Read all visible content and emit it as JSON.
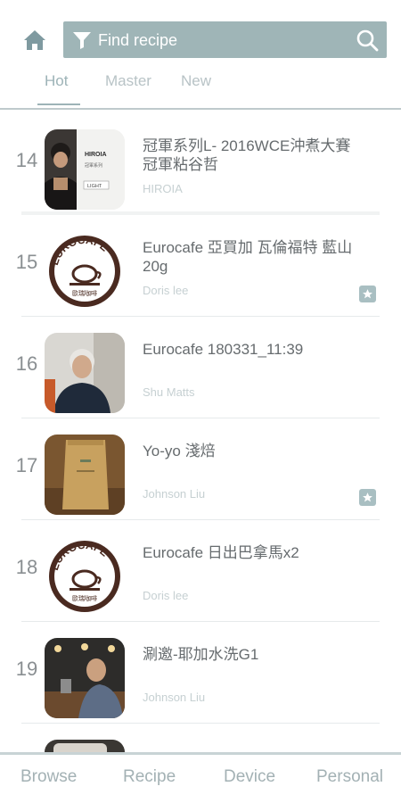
{
  "search": {
    "placeholder": "Find recipe"
  },
  "tabs": [
    {
      "label": "Hot",
      "active": true
    },
    {
      "label": "Master",
      "active": false
    },
    {
      "label": "New",
      "active": false
    }
  ],
  "recipes": [
    {
      "number": "14",
      "title": "冠軍系列L- 2016WCE沖煮大賽冠軍粘谷哲",
      "author": "HIROIA",
      "starred": false,
      "thumb": "hiroia-light-photo"
    },
    {
      "number": "15",
      "title": "Eurocafe 亞買加 瓦倫福特 藍山 20g",
      "author": "Doris lee",
      "starred": true,
      "thumb": "eurocafe-logo"
    },
    {
      "number": "16",
      "title": "Eurocafe 180331_11:39",
      "author": "Shu Matts",
      "starred": false,
      "thumb": "portrait-photo"
    },
    {
      "number": "17",
      "title": "Yo-yo 淺焙",
      "author": "Johnson Liu",
      "starred": true,
      "thumb": "coffee-bag-photo"
    },
    {
      "number": "18",
      "title": "Eurocafe 日出巴拿馬x2",
      "author": "Doris lee",
      "starred": false,
      "thumb": "eurocafe-logo"
    },
    {
      "number": "19",
      "title": "涮邀-耶加水洗G1",
      "author": "Johnson Liu",
      "starred": false,
      "thumb": "bar-photo"
    }
  ],
  "thumb_text": {
    "hiroia_brand": "HIROIA",
    "hiroia_sub": "冠軍系列",
    "hiroia_light": "LIGHT",
    "euro_logo": "EUROCAFE",
    "euro_chinese": "歐瑞咖啡"
  },
  "bottom_nav": [
    {
      "label": "Browse"
    },
    {
      "label": "Recipe"
    },
    {
      "label": "Device"
    },
    {
      "label": "Personal"
    }
  ],
  "colors": {
    "accent": "#9fb5b7",
    "text_primary": "#666b6e",
    "text_muted": "#c6d0d2",
    "star_badge": "#a9bfc2"
  }
}
